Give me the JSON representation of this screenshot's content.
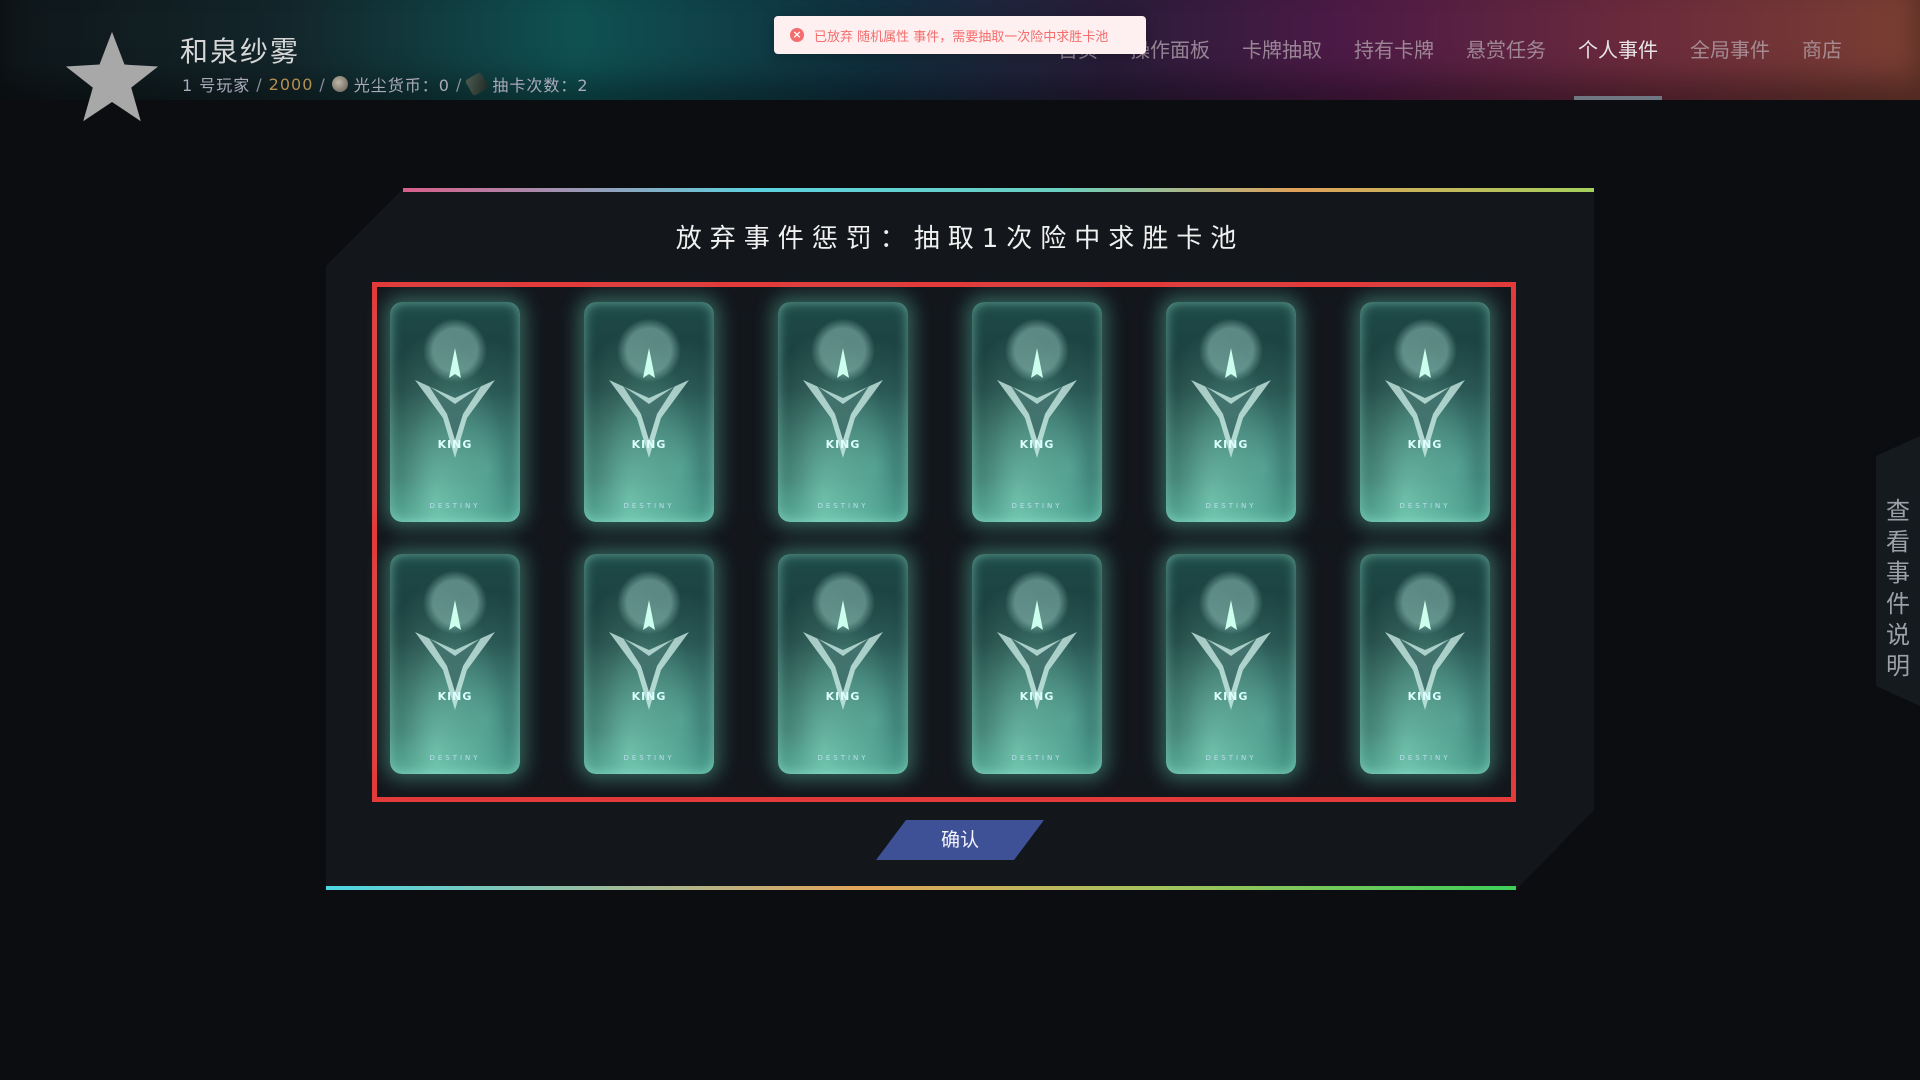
{
  "header": {
    "player_name": "和泉纱雾",
    "player_rank": "1 号玩家",
    "score": "2000",
    "currency_label": "光尘货币：0",
    "draw_count_label": "抽卡次数：2",
    "separator": "/",
    "nav_items": [
      "首页",
      "操作面板",
      "卡牌抽取",
      "持有卡牌",
      "悬赏任务",
      "个人事件",
      "全局事件",
      "商店"
    ],
    "active_nav": "个人事件"
  },
  "toast": {
    "icon": "error-circle-icon",
    "text": "已放弃 随机属性 事件，需要抽取一次险中求胜卡池"
  },
  "panel": {
    "title": "放弃事件惩罚：抽取1次险中求胜卡池",
    "confirm_label": "确认",
    "card_back": {
      "king_text": "KING",
      "logo_text": "DESTINY"
    }
  },
  "side_tab": {
    "label": "查看事件说明"
  },
  "colors": {
    "accent_red": "#e33a3a",
    "confirm_bg": "#3f5196",
    "toast_bg": "#fef0f0",
    "toast_text": "#f56c6c"
  }
}
